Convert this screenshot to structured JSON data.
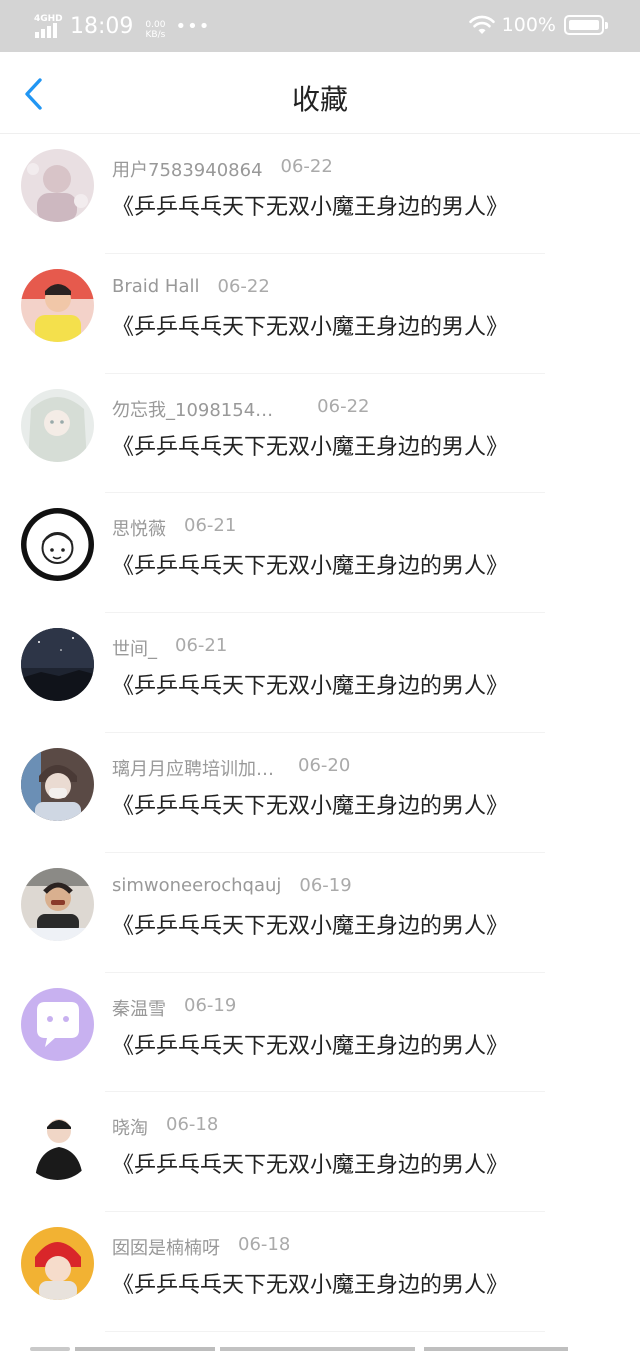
{
  "status_bar": {
    "network": "4GHD",
    "time": "18:09",
    "speed_value": "0.00",
    "speed_unit": "KB/s",
    "dots": "•••",
    "battery": "100%"
  },
  "nav": {
    "title": "收藏"
  },
  "items": [
    {
      "user": "用户7583940864",
      "date": "06-22",
      "title": "《乒乒乓乓天下无双小魔王身边的男人》",
      "avatar": "avatar-blurred-portrait"
    },
    {
      "user": "Braid Hall",
      "date": "06-22",
      "title": "《乒乒乓乓天下无双小魔王身边的男人》",
      "avatar": "avatar-yellow-shirt"
    },
    {
      "user": "勿忘我_1098154…",
      "date": "06-22",
      "title": "《乒乒乓乓天下无双小魔王身边的男人》",
      "avatar": "avatar-anime-girl"
    },
    {
      "user": "思悦薇",
      "date": "06-21",
      "title": "《乒乒乓乓天下无双小魔王身边的男人》",
      "avatar": "avatar-cartoon-face"
    },
    {
      "user": "世间_",
      "date": "06-21",
      "title": "《乒乒乓乓天下无双小魔王身边的男人》",
      "avatar": "avatar-night-sky"
    },
    {
      "user": "璃月月应聘培训加…",
      "date": "06-20",
      "title": "《乒乒乓乓天下无双小魔王身边的男人》",
      "avatar": "avatar-masked-person"
    },
    {
      "user": "simwoneerochqauj",
      "date": "06-19",
      "title": "《乒乒乓乓天下无双小魔王身边的男人》",
      "avatar": "avatar-boy-photo"
    },
    {
      "user": "秦温雪",
      "date": "06-19",
      "title": "《乒乒乓乓天下无双小魔王身边的男人》",
      "avatar": "avatar-chat-bubble"
    },
    {
      "user": "晓淘",
      "date": "06-18",
      "title": "《乒乒乓乓天下无双小魔王身边的男人》",
      "avatar": "avatar-boy-black-shirt"
    },
    {
      "user": "囡囡是楠楠呀",
      "date": "06-18",
      "title": "《乒乒乓乓天下无双小魔王身边的男人》",
      "avatar": "avatar-red-hat"
    }
  ],
  "colors": {
    "status_bar_bg": "#d4d4d4",
    "accent": "#2196f3",
    "meta_text": "#999999",
    "title_text": "#222222"
  }
}
